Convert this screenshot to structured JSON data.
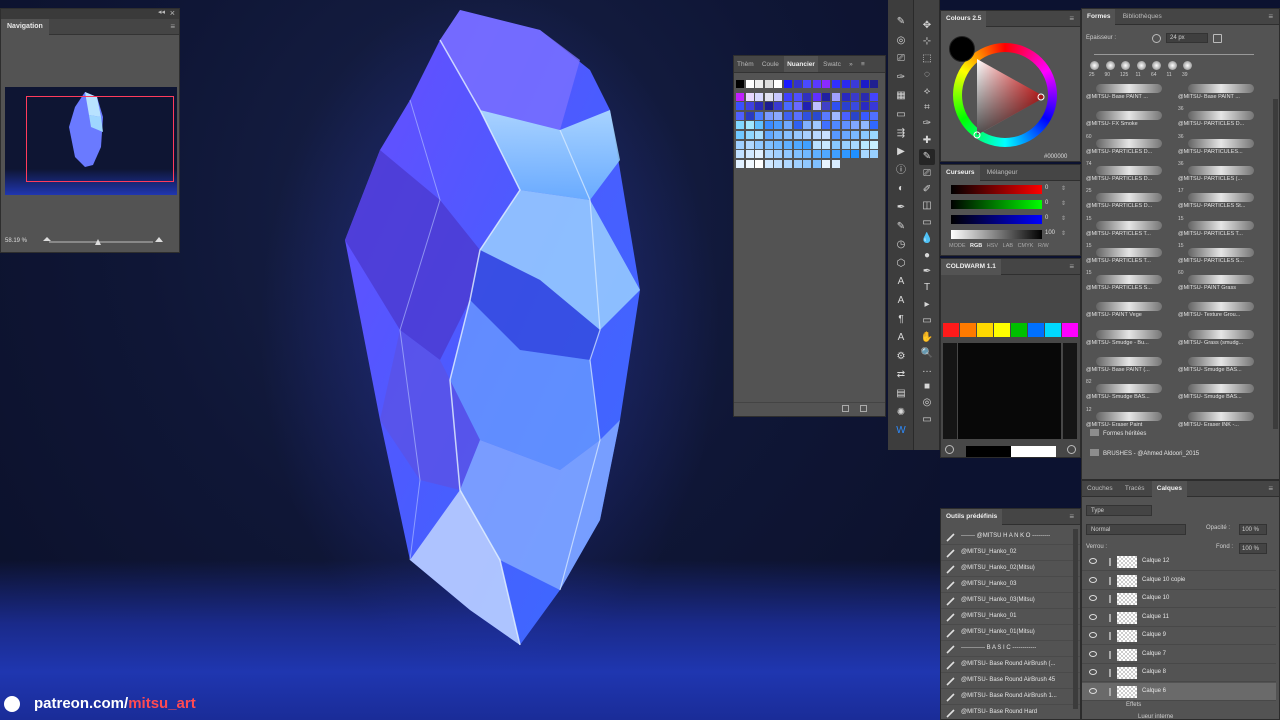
{
  "navigation": {
    "title": "Navigation",
    "zoom": "58.19 %"
  },
  "swatches": {
    "tabs": [
      "Thèm",
      "Coule",
      "Nuancier",
      "Swatc"
    ],
    "active_tab": "Nuancier"
  },
  "colours": {
    "title": "Colours 2.5",
    "hex": "#000000"
  },
  "sliders": {
    "tabs": [
      "Curseurs",
      "Mélangeur"
    ],
    "values": [
      "0",
      "0",
      "0",
      "100"
    ],
    "mode_label": "MODE",
    "modes": [
      "RGB",
      "HSV",
      "LAB",
      "CMYK",
      "R/W"
    ]
  },
  "coldwarm": {
    "title": "COLDWARM 1.1"
  },
  "outils": {
    "title": "Outils prédéfinis",
    "items": [
      "------- @MITSU H A N K O ---------",
      "@MITSU_Hanko_02",
      "@MITSU_Hanko_02(Mitsu)",
      "@MITSU_Hanko_03",
      "@MITSU_Hanko_03(Mitsu)",
      "@MITSU_Hanko_01",
      "@MITSU_Hanko_01(Mitsu)",
      "------------ B A S I C ------------",
      "@MITSU- Base Round AirBrush (...",
      "@MITSU- Base Round AirBrush 45",
      "@MITSU- Base Round AirBrush 1...",
      "@MITSU- Base Round Hard"
    ]
  },
  "formes": {
    "tabs": [
      "Formes",
      "Bibliothèques"
    ],
    "thickness_label": "Epaisseur :",
    "thickness_value": "24 px",
    "preset_sizes": [
      "25",
      "90",
      "125",
      "11",
      "64",
      "11",
      "39"
    ],
    "brushes": [
      {
        "num": "",
        "name": "@MITSU- Base PAINT ..."
      },
      {
        "num": "",
        "name": "@MITSU- Base PAINT ..."
      },
      {
        "num": "",
        "name": "@MITSU- FX Smoke"
      },
      {
        "num": "36",
        "name": "@MITSU- PARTICLES D..."
      },
      {
        "num": "60",
        "name": "@MITSU- PARTICLES D..."
      },
      {
        "num": "36",
        "name": "@MITSU- PARTICULES..."
      },
      {
        "num": "74",
        "name": "@MITSU- PARTICLES D..."
      },
      {
        "num": "36",
        "name": "@MITSU- PARTICLES (..."
      },
      {
        "num": "25",
        "name": "@MITSU- PARTICLES D..."
      },
      {
        "num": "17",
        "name": "@MITSU- PARTICLES St..."
      },
      {
        "num": "15",
        "name": "@MITSU- PARTICLES T..."
      },
      {
        "num": "15",
        "name": "@MITSU- PARTICLES T..."
      },
      {
        "num": "15",
        "name": "@MITSU- PARTICLES T..."
      },
      {
        "num": "15",
        "name": "@MITSU- PARTICLES S..."
      },
      {
        "num": "15",
        "name": "@MITSU- PARTICLES S..."
      },
      {
        "num": "60",
        "name": "@MITSU- PAINT Grass"
      },
      {
        "num": "",
        "name": "@MITSU- PAINT Vege"
      },
      {
        "num": "",
        "name": "@MITSU- Texture Grou..."
      },
      {
        "num": "",
        "name": "@MITSU- Smudge - Bu..."
      },
      {
        "num": "",
        "name": "@MITSU- Grass (smudg..."
      },
      {
        "num": "",
        "name": "@MITSU- Base PAINT (..."
      },
      {
        "num": "",
        "name": "@MITSU- Smudge BAS..."
      },
      {
        "num": "82",
        "name": "@MITSU- Smudge BAS..."
      },
      {
        "num": "",
        "name": "@MITSU- Smudge BAS..."
      },
      {
        "num": "12",
        "name": "@MITSU- Eraser Paint"
      },
      {
        "num": "",
        "name": "@MITSU- Eraser INK -..."
      }
    ],
    "folders": [
      "Formes héritées",
      "BRUSHES - @Ahmed Aldoori_2015"
    ]
  },
  "calques": {
    "tabs": [
      "Couches",
      "Tracés",
      "Calques"
    ],
    "active_tab": "Calques",
    "filter": "Type",
    "blend_mode": "Normal",
    "opacity_label": "Opacité :",
    "opacity_value": "100 %",
    "lock_label": "Verrou :",
    "fill_label": "Fond :",
    "fill_value": "100 %",
    "layers": [
      "Calque 12",
      "Calque 10 copie",
      "Calque 10",
      "Calque 11",
      "Calque 9",
      "Calque 7",
      "Calque 8",
      "Calque 6"
    ],
    "effects_label": "Effets",
    "effect_item": "Lueur interne"
  },
  "banner": {
    "prefix": "patreon.com/",
    "handle": "mitsu_art"
  },
  "colors": {
    "accent": "#ff4a52",
    "panel": "#535353",
    "nav_view_box": "#ff3b5c"
  }
}
